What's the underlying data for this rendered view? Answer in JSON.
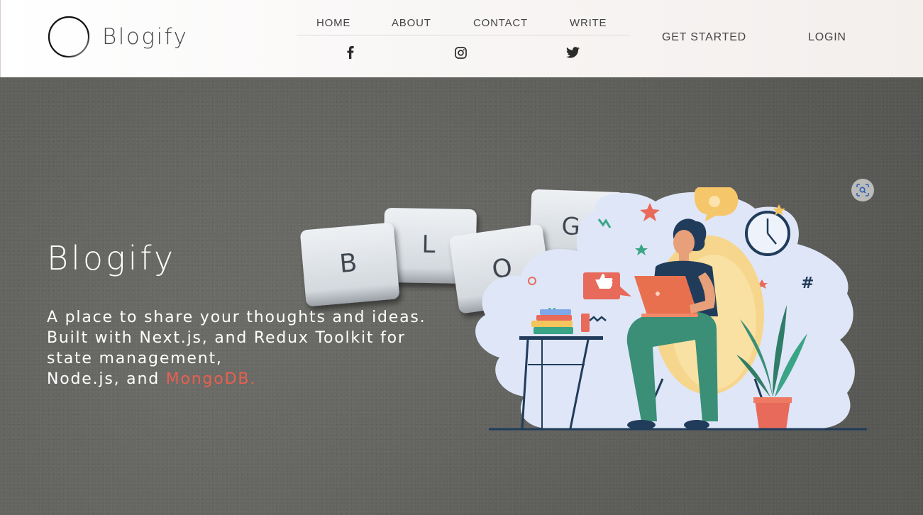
{
  "brand": {
    "name": "Blogify",
    "logo_icon": "circle-logo-icon"
  },
  "nav": {
    "links": [
      {
        "label": "HOME"
      },
      {
        "label": "ABOUT"
      },
      {
        "label": "CONTACT"
      },
      {
        "label": "WRITE"
      }
    ],
    "socials": [
      {
        "icon": "facebook-icon"
      },
      {
        "icon": "instagram-icon"
      },
      {
        "icon": "twitter-icon"
      }
    ]
  },
  "actions": {
    "get_started": "GET STARTED",
    "login": "LOGIN"
  },
  "hero": {
    "title": "Blogify",
    "desc_line1": "A place to share your thoughts and ideas.",
    "desc_line2": "Built with Next.js, and Redux Toolkit for",
    "desc_line3": "state management,",
    "desc_line4_prefix": "Node.js, and ",
    "desc_line4_accent": "MongoDB.",
    "tiles": [
      "B",
      "L",
      "O",
      "G"
    ],
    "accent_color": "#e8604f"
  },
  "overlay": {
    "focus_icon": "visual-search-icon"
  }
}
